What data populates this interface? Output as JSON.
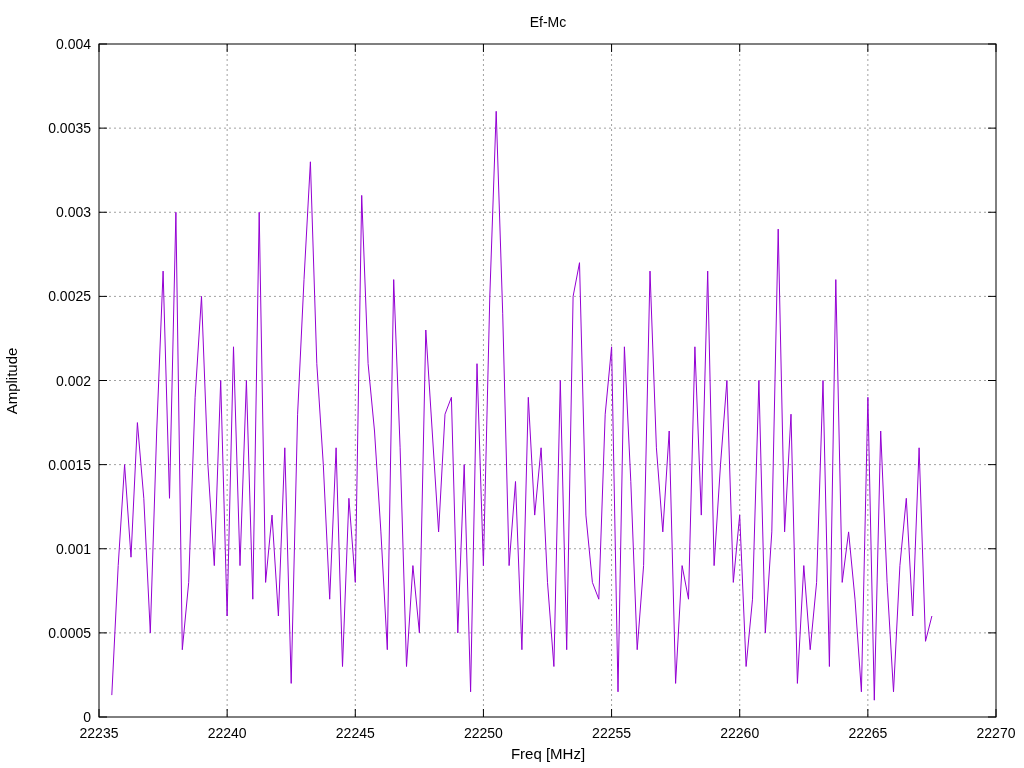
{
  "chart_data": {
    "type": "line",
    "grid": true,
    "title": "Ef-Mc",
    "xlabel": "Freq [MHz]",
    "ylabel": "Amplitude",
    "xlim": [
      22235,
      22270
    ],
    "ylim": [
      0,
      0.004
    ],
    "xticks": [
      22235,
      22240,
      22245,
      22250,
      22255,
      22260,
      22265,
      22270
    ],
    "yticks": [
      0,
      0.0005,
      0.001,
      0.0015,
      0.002,
      0.0025,
      0.003,
      0.0035,
      0.004
    ],
    "x": [
      22235.5,
      22235.75,
      22236,
      22236.25,
      22236.5,
      22236.75,
      22237,
      22237.25,
      22237.5,
      22237.75,
      22238,
      22238.25,
      22238.5,
      22238.75,
      22239,
      22239.25,
      22239.5,
      22239.75,
      22240,
      22240.25,
      22240.5,
      22240.75,
      22241,
      22241.25,
      22241.5,
      22241.75,
      22242,
      22242.25,
      22242.5,
      22242.75,
      22243,
      22243.25,
      22243.5,
      22243.75,
      22244,
      22244.25,
      22244.5,
      22244.75,
      22245,
      22245.25,
      22245.5,
      22245.75,
      22246,
      22246.25,
      22246.5,
      22246.75,
      22247,
      22247.25,
      22247.5,
      22247.75,
      22248,
      22248.25,
      22248.5,
      22248.75,
      22249,
      22249.25,
      22249.5,
      22249.75,
      22250,
      22250.25,
      22250.5,
      22250.75,
      22251,
      22251.25,
      22251.5,
      22251.75,
      22252,
      22252.25,
      22252.5,
      22252.75,
      22253,
      22253.25,
      22253.5,
      22253.75,
      22254,
      22254.25,
      22254.5,
      22254.75,
      22255,
      22255.25,
      22255.5,
      22255.75,
      22256,
      22256.25,
      22256.5,
      22256.75,
      22257,
      22257.25,
      22257.5,
      22257.75,
      22258,
      22258.25,
      22258.5,
      22258.75,
      22259,
      22259.25,
      22259.5,
      22259.75,
      22260,
      22260.25,
      22260.5,
      22260.75,
      22261,
      22261.25,
      22261.5,
      22261.75,
      22262,
      22262.25,
      22262.5,
      22262.75,
      22263,
      22263.25,
      22263.5,
      22263.75,
      22264,
      22264.25,
      22264.5,
      22264.75,
      22265,
      22265.25,
      22265.5,
      22265.75,
      22266,
      22266.25,
      22266.5,
      22266.75,
      22267,
      22267.25,
      22267.5
    ],
    "series": [
      {
        "color": "#9400d3",
        "values": [
          0.00013,
          0.0009,
          0.0015,
          0.00095,
          0.00175,
          0.0013,
          0.0005,
          0.0017,
          0.00265,
          0.0013,
          0.003,
          0.0004,
          0.0008,
          0.0019,
          0.0025,
          0.0015,
          0.0009,
          0.002,
          0.0006,
          0.0022,
          0.0009,
          0.002,
          0.0007,
          0.003,
          0.0008,
          0.0012,
          0.0006,
          0.0016,
          0.0002,
          0.0018,
          0.0026,
          0.0033,
          0.0021,
          0.0015,
          0.0007,
          0.0016,
          0.0003,
          0.0013,
          0.0008,
          0.0031,
          0.0021,
          0.0017,
          0.0011,
          0.0004,
          0.0026,
          0.0016,
          0.0003,
          0.0009,
          0.0005,
          0.0023,
          0.0017,
          0.0011,
          0.0018,
          0.0019,
          0.0005,
          0.0015,
          0.00015,
          0.0021,
          0.0009,
          0.0025,
          0.0036,
          0.0024,
          0.0009,
          0.0014,
          0.0004,
          0.0019,
          0.0012,
          0.0016,
          0.0008,
          0.0003,
          0.002,
          0.0004,
          0.0025,
          0.0027,
          0.0012,
          0.0008,
          0.0007,
          0.0018,
          0.0022,
          0.00015,
          0.0022,
          0.0014,
          0.0004,
          0.0009,
          0.00265,
          0.0016,
          0.0011,
          0.0017,
          0.0002,
          0.0009,
          0.0007,
          0.0022,
          0.0012,
          0.00265,
          0.0009,
          0.0015,
          0.002,
          0.0008,
          0.0012,
          0.0003,
          0.0007,
          0.002,
          0.0005,
          0.0011,
          0.0029,
          0.0011,
          0.0018,
          0.0002,
          0.0009,
          0.0004,
          0.0008,
          0.002,
          0.0003,
          0.0026,
          0.0008,
          0.0011,
          0.0007,
          0.00015,
          0.0019,
          0.0001,
          0.0017,
          0.0008,
          0.00015,
          0.0009,
          0.0013,
          0.0006,
          0.0016,
          0.00045,
          0.0006
        ]
      }
    ]
  }
}
